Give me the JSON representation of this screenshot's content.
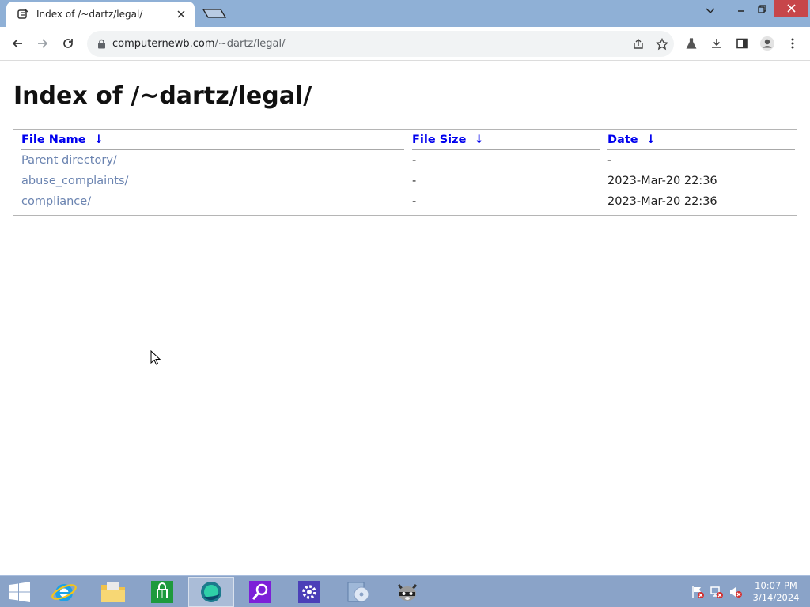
{
  "browser": {
    "tab_title": "Index of /~dartz/legal/",
    "url_host": "computernewb.com",
    "url_path": "/~dartz/legal/"
  },
  "page": {
    "heading": "Index of /~dartz/legal/",
    "columns": [
      {
        "label": "File Name",
        "sort_arrow": "↓"
      },
      {
        "label": "File Size",
        "sort_arrow": "↓"
      },
      {
        "label": "Date",
        "sort_arrow": "↓"
      }
    ],
    "rows": [
      {
        "name": "Parent directory/",
        "size": "-",
        "date": "-"
      },
      {
        "name": "abuse_complaints/",
        "size": "-",
        "date": "2023-Mar-20 22:36"
      },
      {
        "name": "compliance/",
        "size": "-",
        "date": "2023-Mar-20 22:36"
      }
    ],
    "link_color": "#6a83b0"
  },
  "taskbar": {
    "time": "10:07 PM",
    "date": "3/14/2024",
    "pinned": [
      "start-icon",
      "internet-explorer-icon",
      "file-explorer-icon",
      "store-icon",
      "browser-icon",
      "search-app-icon",
      "settings-icon",
      "media-disc-icon",
      "raccoon-app-icon"
    ]
  },
  "colors": {
    "titlebar": "#8fb0d6",
    "close": "#c7464a",
    "taskbar": "#8aa3c8"
  }
}
